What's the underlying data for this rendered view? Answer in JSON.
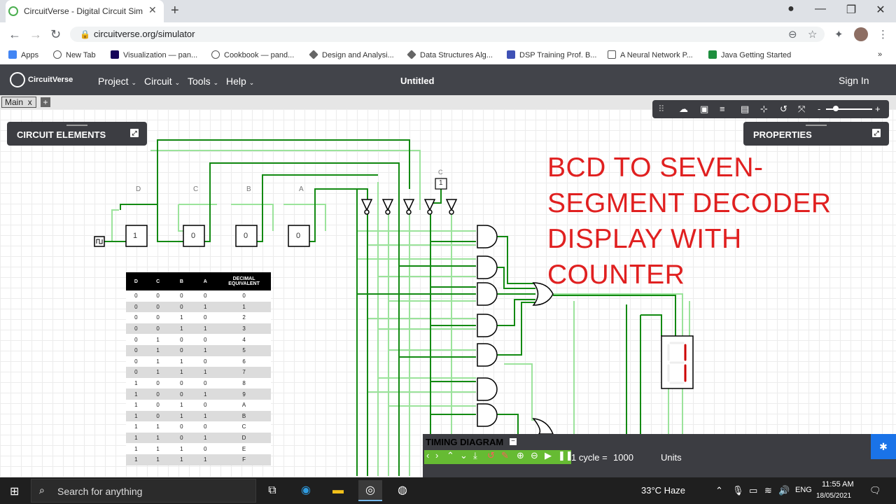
{
  "browser": {
    "tab_title": "CircuitVerse - Digital Circuit Simu",
    "url": "circuitverse.org/simulator",
    "bookmarks": [
      "Apps",
      "New Tab",
      "Visualization — pan...",
      "Cookbook — pand...",
      "Design and Analysi...",
      "Data Structures Alg...",
      "DSP Training Prof. B...",
      "A Neural Network P...",
      "Java Getting Started"
    ]
  },
  "app": {
    "logo": "CircuitVerse",
    "menus": [
      "Project",
      "Circuit",
      "Tools",
      "Help"
    ],
    "project_title": "Untitled",
    "signin": "Sign In",
    "circuit_tab": "Main",
    "circuit_tab_close": "x"
  },
  "panels": {
    "elements_title": "CIRCUIT ELEMENTS",
    "properties_title": "PROPERTIES"
  },
  "canvas": {
    "heading_lines": [
      "BCD TO SEVEN-",
      "SEGMENT DECODER",
      "DISPLAY WITH",
      "COUNTER"
    ],
    "flipflop_labels": [
      "D",
      "C",
      "B",
      "A"
    ],
    "flipflop_values": [
      "1",
      "0",
      "0",
      "0"
    ],
    "constant_label": "C",
    "constant_value": "1"
  },
  "truth_table": {
    "headers": [
      "D",
      "C",
      "B",
      "A",
      "DECIMAL EQUIVALENT"
    ],
    "rows": [
      [
        "0",
        "0",
        "0",
        "0",
        "0"
      ],
      [
        "0",
        "0",
        "0",
        "1",
        "1"
      ],
      [
        "0",
        "0",
        "1",
        "0",
        "2"
      ],
      [
        "0",
        "0",
        "1",
        "1",
        "3"
      ],
      [
        "0",
        "1",
        "0",
        "0",
        "4"
      ],
      [
        "0",
        "1",
        "0",
        "1",
        "5"
      ],
      [
        "0",
        "1",
        "1",
        "0",
        "6"
      ],
      [
        "0",
        "1",
        "1",
        "1",
        "7"
      ],
      [
        "1",
        "0",
        "0",
        "0",
        "8"
      ],
      [
        "1",
        "0",
        "0",
        "1",
        "9"
      ],
      [
        "1",
        "0",
        "1",
        "0",
        "A"
      ],
      [
        "1",
        "0",
        "1",
        "1",
        "B"
      ],
      [
        "1",
        "1",
        "0",
        "0",
        "C"
      ],
      [
        "1",
        "1",
        "0",
        "1",
        "D"
      ],
      [
        "1",
        "1",
        "1",
        "0",
        "E"
      ],
      [
        "1",
        "1",
        "1",
        "1",
        "F"
      ]
    ]
  },
  "timing": {
    "title": "TIMING DIAGRAM",
    "cycle_label": "1 cycle =",
    "cycle_value": "1000",
    "units": "Units"
  },
  "taskbar": {
    "search_placeholder": "Search for anything",
    "weather": "33°C  Haze",
    "lang": "ENG",
    "time": "11:55 AM",
    "date": "18/05/2021"
  }
}
